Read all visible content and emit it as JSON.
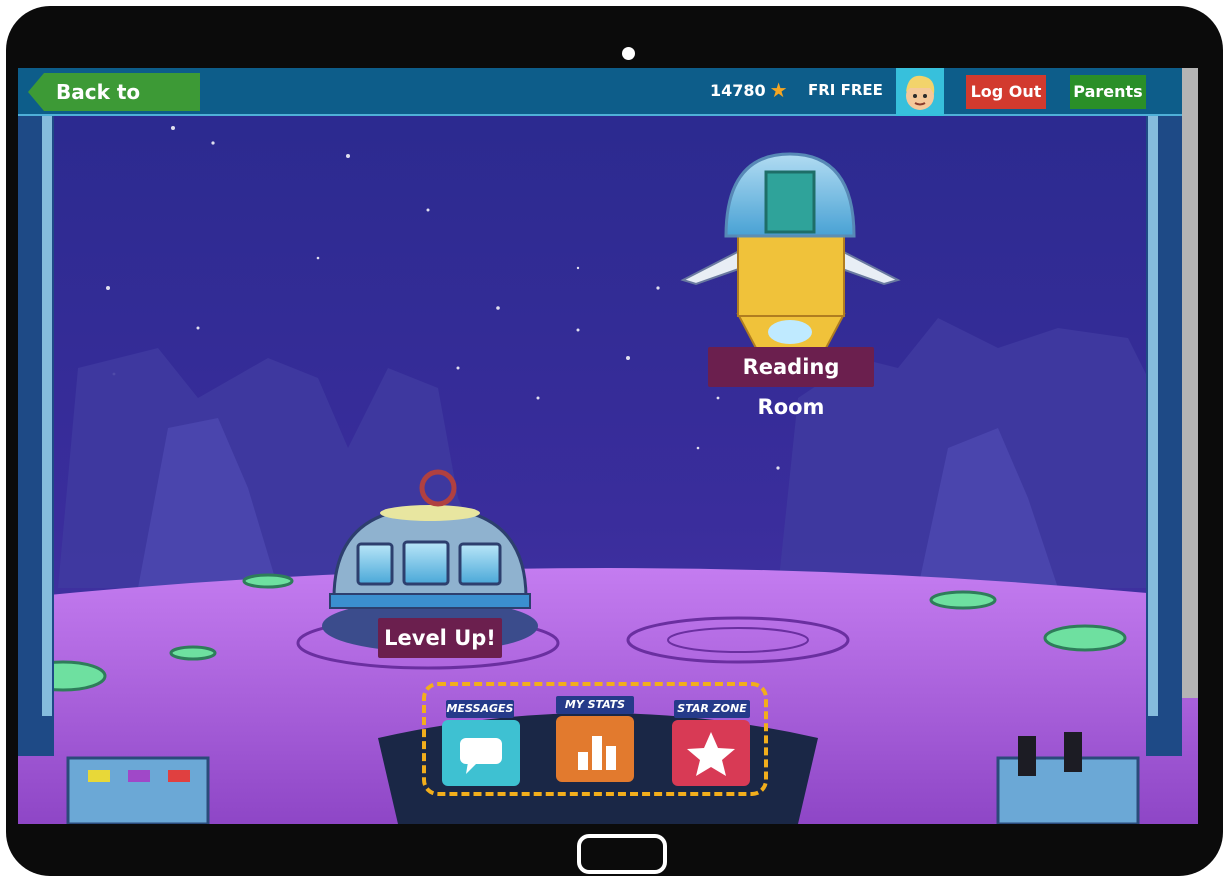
{
  "header": {
    "back_label": "Back to Home",
    "points": "14780",
    "plan_label": "FRI FREE",
    "logout_label": "Log Out",
    "parents_label": "Parents"
  },
  "scene": {
    "reading_room_label": "Reading Room",
    "level_up_label": "Level Up!"
  },
  "console": {
    "messages_label": "MESSAGES",
    "stats_label": "MY STATS",
    "starzone_label": "STAR ZONE"
  },
  "icons": {
    "back": "arrow-left-icon",
    "points": "star-icon",
    "messages": "chat-bubble-icon",
    "stats": "bar-chart-icon",
    "starzone": "star-icon"
  },
  "colors": {
    "topbar": "#0d5d8a",
    "back_button": "#3d9a36",
    "logout_button": "#d23a2e",
    "parents_button": "#2a8f28",
    "label_plate": "#6b1f4e",
    "highlight": "#f2ae1c",
    "messages_tile": "#3ec1d2",
    "stats_tile": "#e27a2e",
    "starzone_tile": "#d83a55",
    "planet_surface": "#b36be0"
  }
}
